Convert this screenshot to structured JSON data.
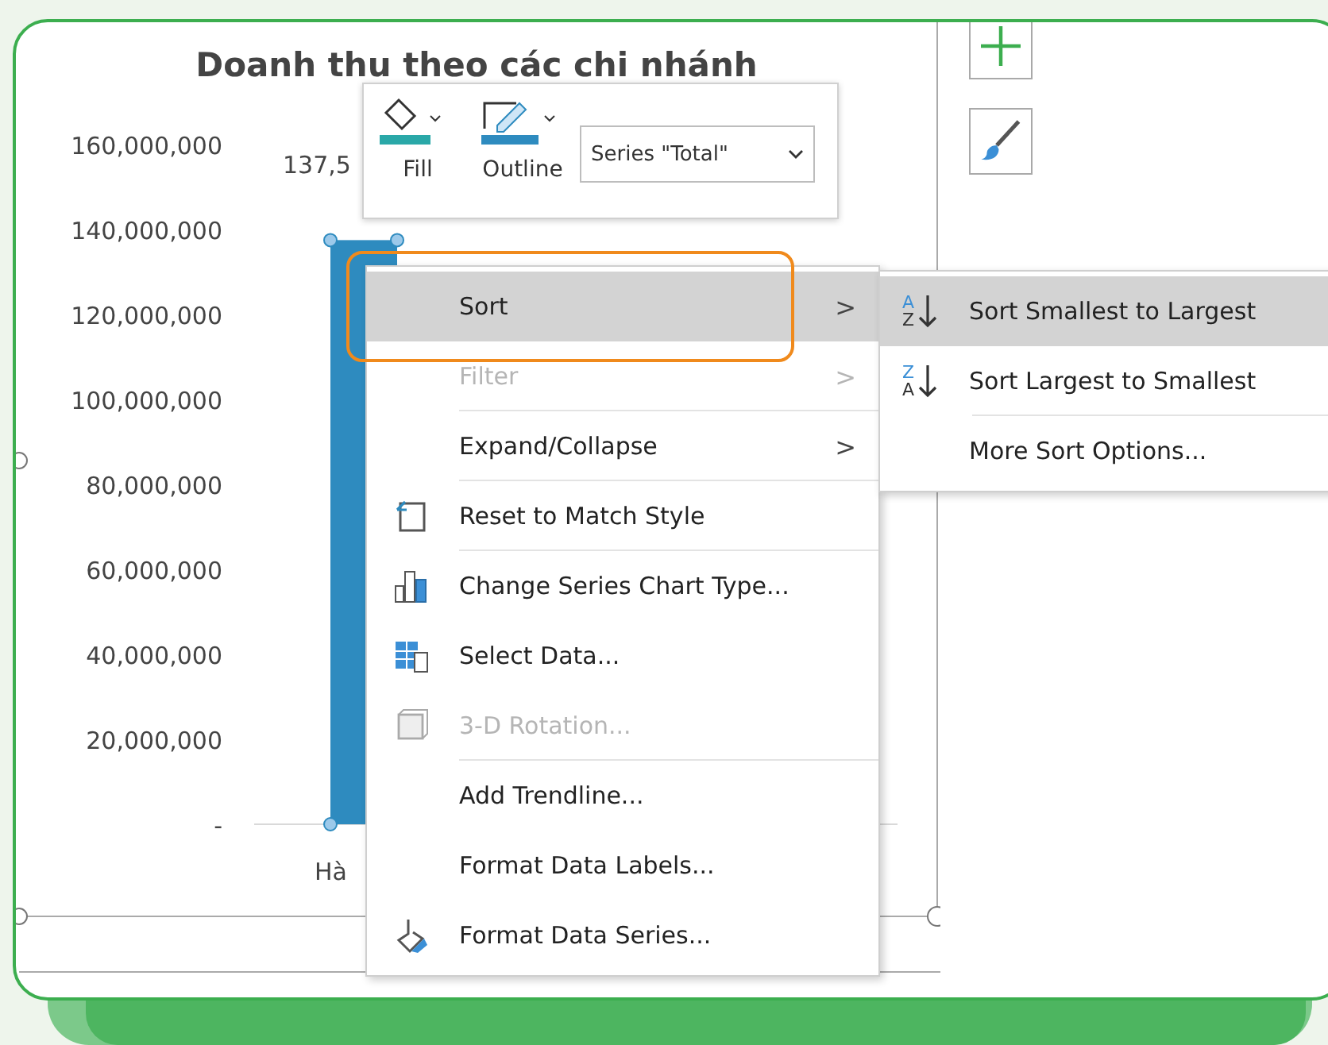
{
  "chart": {
    "bar_label": "137,5",
    "chart_data": {
      "type": "bar",
      "title": "Doanh thu theo các chi nhánh",
      "categories": [
        "Hà"
      ],
      "values": [
        137500000
      ],
      "ylim": [
        0,
        160000000
      ],
      "yticks": [
        {
          "value": 0,
          "label": "-"
        },
        {
          "value": 20000000,
          "label": "20,000,000"
        },
        {
          "value": 40000000,
          "label": "40,000,000"
        },
        {
          "value": 60000000,
          "label": "60,000,000"
        },
        {
          "value": 80000000,
          "label": "80,000,000"
        },
        {
          "value": 100000000,
          "label": "100,000,000"
        },
        {
          "value": 120000000,
          "label": "120,000,000"
        },
        {
          "value": 140000000,
          "label": "140,000,000"
        },
        {
          "value": 160000000,
          "label": "160,000,000"
        }
      ]
    }
  },
  "mini_toolbar": {
    "buttons": [
      {
        "label": "Fill",
        "kind": "fill"
      },
      {
        "label": "Outline",
        "kind": "outline"
      }
    ],
    "series_dropdown": "Series \"Total\""
  },
  "side_buttons": [
    {
      "kind": "plus"
    },
    {
      "kind": "brush"
    }
  ],
  "context_menu": {
    "items": [
      {
        "label": "Sort",
        "kind": "plain",
        "submenu": true,
        "disabled": false,
        "selected": true,
        "separator_after": false
      },
      {
        "label": "Filter",
        "kind": "plain",
        "submenu": true,
        "disabled": true,
        "selected": false,
        "separator_after": true
      },
      {
        "label": "Expand/Collapse",
        "kind": "plain",
        "submenu": true,
        "disabled": false,
        "selected": false,
        "separator_after": true
      },
      {
        "label": "Reset to Match Style",
        "kind": "reset",
        "submenu": false,
        "disabled": false,
        "selected": false,
        "separator_after": true
      },
      {
        "label": "Change Series Chart Type...",
        "kind": "chart",
        "submenu": false,
        "disabled": false,
        "selected": false,
        "separator_after": false
      },
      {
        "label": "Select Data...",
        "kind": "table",
        "submenu": false,
        "disabled": false,
        "selected": false,
        "separator_after": false
      },
      {
        "label": "3-D Rotation...",
        "kind": "cube",
        "submenu": false,
        "disabled": true,
        "selected": false,
        "separator_after": true
      },
      {
        "label": "Add Trendline...",
        "kind": "plain",
        "submenu": false,
        "disabled": false,
        "selected": false,
        "separator_after": false
      },
      {
        "label": "Format Data Labels...",
        "kind": "plain",
        "submenu": false,
        "disabled": false,
        "selected": false,
        "separator_after": false
      },
      {
        "label": "Format Data Series...",
        "kind": "paint",
        "submenu": false,
        "disabled": false,
        "selected": false,
        "separator_after": false
      }
    ]
  },
  "submenu": {
    "items": [
      {
        "label": "Sort Smallest to Largest",
        "kind": "sort",
        "icon_letters": [
          "A",
          "Z"
        ],
        "selected": true,
        "separator_after": false
      },
      {
        "label": "Sort Largest to Smallest",
        "kind": "sort",
        "icon_letters": [
          "Z",
          "A"
        ],
        "selected": false,
        "separator_after": true
      },
      {
        "label": "More Sort Options...",
        "kind": "plain",
        "selected": false,
        "separator_after": false
      }
    ]
  },
  "submenu_arrow": ">"
}
